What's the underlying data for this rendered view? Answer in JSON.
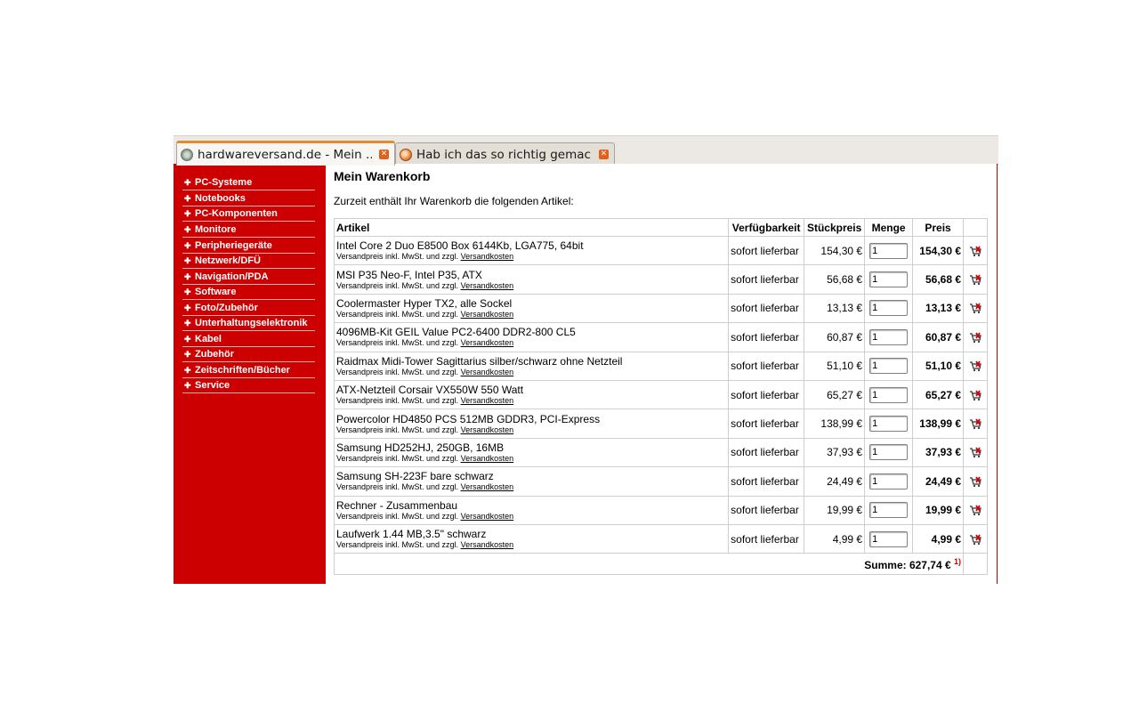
{
  "browser": {
    "tabs": [
      {
        "title": "hardwareversand.de - Mein ...",
        "active": true,
        "icon": "globe-icon"
      },
      {
        "title": "Hab ich das so richtig gemac...",
        "active": false,
        "icon": "forum-favicon-icon"
      }
    ]
  },
  "sidebar": {
    "items": [
      {
        "label": "PC-Systeme"
      },
      {
        "label": "Notebooks"
      },
      {
        "label": "PC-Komponenten"
      },
      {
        "label": "Monitore"
      },
      {
        "label": "Peripheriegeräte"
      },
      {
        "label": "Netzwerk/DFÜ"
      },
      {
        "label": "Navigation/PDA"
      },
      {
        "label": "Software"
      },
      {
        "label": "Foto/Zubehör"
      },
      {
        "label": "Unterhaltungselektronik"
      },
      {
        "label": "Kabel"
      },
      {
        "label": "Zubehör"
      },
      {
        "label": "Zeitschriften/Bücher"
      },
      {
        "label": "Service"
      }
    ]
  },
  "page": {
    "title": "Mein Warenkorb",
    "intro": "Zurzeit enthält Ihr Warenkorb die folgenden Artikel:"
  },
  "cart": {
    "headers": {
      "artikel": "Artikel",
      "verfuegbarkeit": "Verfügbarkeit",
      "stueckpreis": "Stückpreis",
      "menge": "Menge",
      "preis": "Preis"
    },
    "shipping_note_prefix": "Versandpreis inkl. MwSt. und zzgl.",
    "shipping_link": "Versandkosten",
    "rows": [
      {
        "name": "Intel Core 2 Duo E8500 Box 6144Kb, LGA775, 64bit",
        "availability": "sofort lieferbar",
        "unit_price": "154,30 €",
        "qty": "1",
        "price": "154,30 €"
      },
      {
        "name": "MSI P35 Neo-F, Intel P35, ATX",
        "availability": "sofort lieferbar",
        "unit_price": "56,68 €",
        "qty": "1",
        "price": "56,68 €"
      },
      {
        "name": "Coolermaster Hyper TX2, alle Sockel",
        "availability": "sofort lieferbar",
        "unit_price": "13,13 €",
        "qty": "1",
        "price": "13,13 €"
      },
      {
        "name": "4096MB-Kit GEIL Value PC2-6400 DDR2-800 CL5",
        "availability": "sofort lieferbar",
        "unit_price": "60,87 €",
        "qty": "1",
        "price": "60,87 €"
      },
      {
        "name": "Raidmax Midi-Tower Sagittarius silber/schwarz ohne Netzteil",
        "availability": "sofort lieferbar",
        "unit_price": "51,10 €",
        "qty": "1",
        "price": "51,10 €"
      },
      {
        "name": "ATX-Netzteil Corsair VX550W 550 Watt",
        "availability": "sofort lieferbar",
        "unit_price": "65,27 €",
        "qty": "1",
        "price": "65,27 €"
      },
      {
        "name": "Powercolor HD4850 PCS 512MB GDDR3, PCI-Express",
        "availability": "sofort lieferbar",
        "unit_price": "138,99 €",
        "qty": "1",
        "price": "138,99 €"
      },
      {
        "name": "Samsung HD252HJ, 250GB, 16MB",
        "availability": "sofort lieferbar",
        "unit_price": "37,93 €",
        "qty": "1",
        "price": "37,93 €"
      },
      {
        "name": "Samsung SH-223F bare schwarz",
        "availability": "sofort lieferbar",
        "unit_price": "24,49 €",
        "qty": "1",
        "price": "24,49 €"
      },
      {
        "name": "Rechner - Zusammenbau",
        "availability": "sofort lieferbar",
        "unit_price": "19,99 €",
        "qty": "1",
        "price": "19,99 €"
      },
      {
        "name": "Laufwerk 1.44 MB,3.5\" schwarz",
        "availability": "sofort lieferbar",
        "unit_price": "4,99 €",
        "qty": "1",
        "price": "4,99 €"
      }
    ],
    "sum_label": "Summe: 627,74 €",
    "sum_footnote": "1)"
  },
  "colors": {
    "sidebar_bg": "#cc0000",
    "active_tab_accent": "#e48a2f",
    "tab_close": "#e1601c"
  }
}
